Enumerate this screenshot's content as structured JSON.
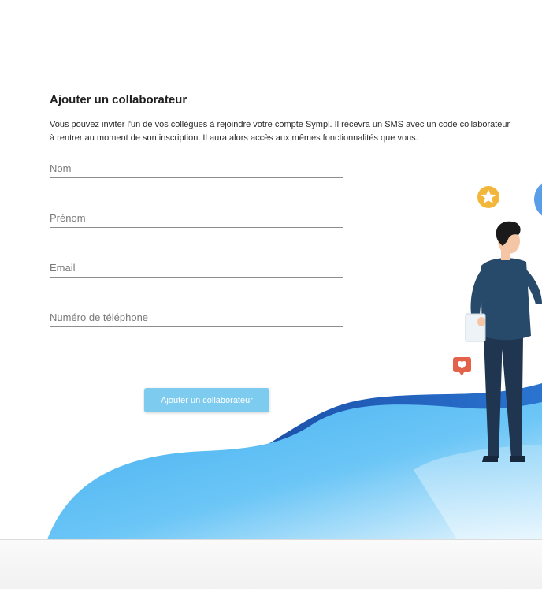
{
  "form": {
    "title": "Ajouter un collaborateur",
    "description": "Vous pouvez inviter l'un de vos collègues à rejoindre votre compte Sympl. Il recevra un SMS avec un code collaborateur à rentrer au moment de son inscription. Il aura alors accès aux mêmes fonctionnalités que vous.",
    "fields": {
      "nom": {
        "placeholder": "Nom",
        "value": ""
      },
      "prenom": {
        "placeholder": "Prénom",
        "value": ""
      },
      "email": {
        "placeholder": "Email",
        "value": ""
      },
      "phone": {
        "placeholder": "Numéro de téléphone",
        "value": ""
      }
    },
    "submit_label": "Ajouter un collaborateur"
  },
  "colors": {
    "accent": "#7ecbf0",
    "wave_light": "#5bbcf3",
    "wave_dark": "#1e5fbf",
    "star_badge": "#f2b63a",
    "heart_badge": "#e4614a",
    "person_shirt": "#274a6b",
    "person_pants": "#1f3550"
  },
  "icons": {
    "star": "star-icon",
    "heart": "heart-icon"
  }
}
